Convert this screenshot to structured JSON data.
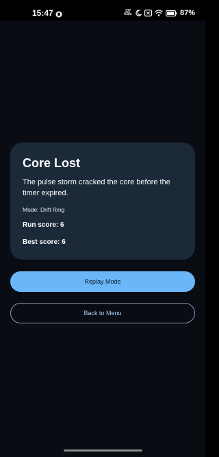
{
  "status_bar": {
    "time": "15:47",
    "net_speed_value": "137",
    "net_speed_unit": "KB/s",
    "battery_percent": "87%",
    "icons": [
      "notification-icon",
      "moon-icon",
      "sim-icon",
      "wifi-icon",
      "battery-icon"
    ]
  },
  "result_card": {
    "title": "Core Lost",
    "message": "The pulse storm cracked the core before the timer expired.",
    "mode": "Mode: Drift Ring",
    "run_score": "Run score: 6",
    "best_score": "Best score: 6"
  },
  "actions": {
    "replay_label": "Replay Mode",
    "menu_label": "Back to Menu"
  },
  "colors": {
    "background": "#090d13",
    "card": "#1b2938",
    "primary_button": "#6bb6f8",
    "secondary_button_text": "#a9cff6"
  }
}
